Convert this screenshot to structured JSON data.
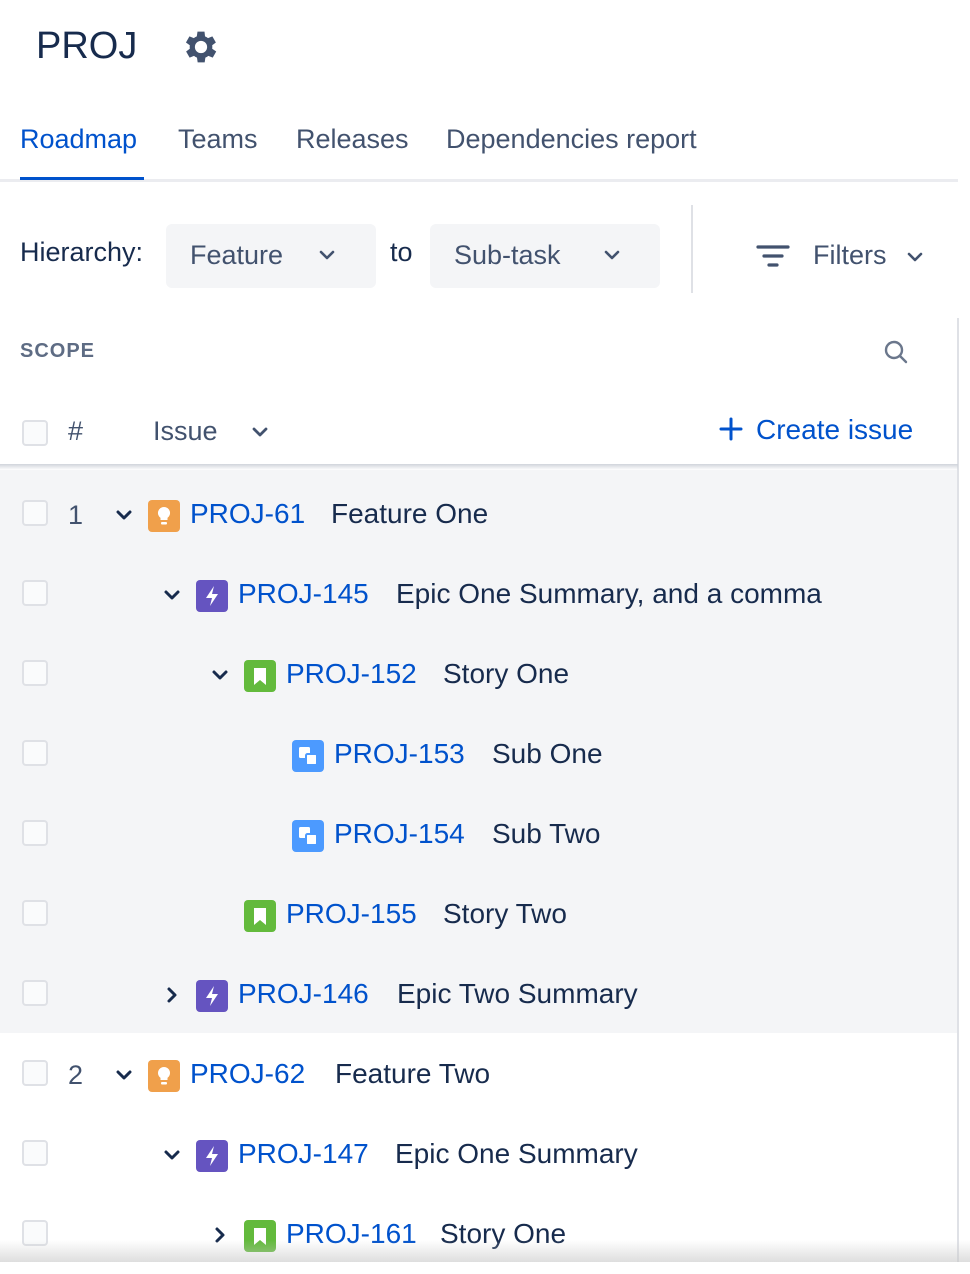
{
  "project": {
    "title": "PROJ"
  },
  "tabs": [
    "Roadmap",
    "Teams",
    "Releases",
    "Dependencies report"
  ],
  "hierarchy": {
    "label": "Hierarchy:",
    "from": "Feature",
    "to_label": "to",
    "to": "Sub-task"
  },
  "filters": {
    "label": "Filters"
  },
  "scope": {
    "title": "SCOPE"
  },
  "columns": {
    "number": "#",
    "issue": "Issue",
    "create": "Create issue"
  },
  "colors": {
    "accent": "#0052cc",
    "feature": "#f0a04b",
    "epic": "#6554c0",
    "story": "#63ba3c",
    "subtask": "#4c9aff"
  },
  "rows": [
    {
      "num": "1",
      "expand": "expanded",
      "type": "feature",
      "key": "PROJ-61",
      "summary": "Feature One"
    },
    {
      "num": "",
      "expand": "expanded",
      "type": "epic",
      "key": "PROJ-145",
      "summary": "Epic One Summary, and a comma"
    },
    {
      "num": "",
      "expand": "expanded",
      "type": "story",
      "key": "PROJ-152",
      "summary": "Story One"
    },
    {
      "num": "",
      "expand": "none",
      "type": "subtask",
      "key": "PROJ-153",
      "summary": "Sub One"
    },
    {
      "num": "",
      "expand": "none",
      "type": "subtask",
      "key": "PROJ-154",
      "summary": "Sub Two"
    },
    {
      "num": "",
      "expand": "none",
      "type": "story",
      "key": "PROJ-155",
      "summary": "Story Two"
    },
    {
      "num": "",
      "expand": "collapsed",
      "type": "epic",
      "key": "PROJ-146",
      "summary": "Epic Two Summary"
    },
    {
      "num": "2",
      "expand": "expanded",
      "type": "feature",
      "key": "PROJ-62",
      "summary": "Feature Two"
    },
    {
      "num": "",
      "expand": "expanded",
      "type": "epic",
      "key": "PROJ-147",
      "summary": "Epic One Summary"
    },
    {
      "num": "",
      "expand": "collapsed",
      "type": "story",
      "key": "PROJ-161",
      "summary": "Story One"
    }
  ]
}
